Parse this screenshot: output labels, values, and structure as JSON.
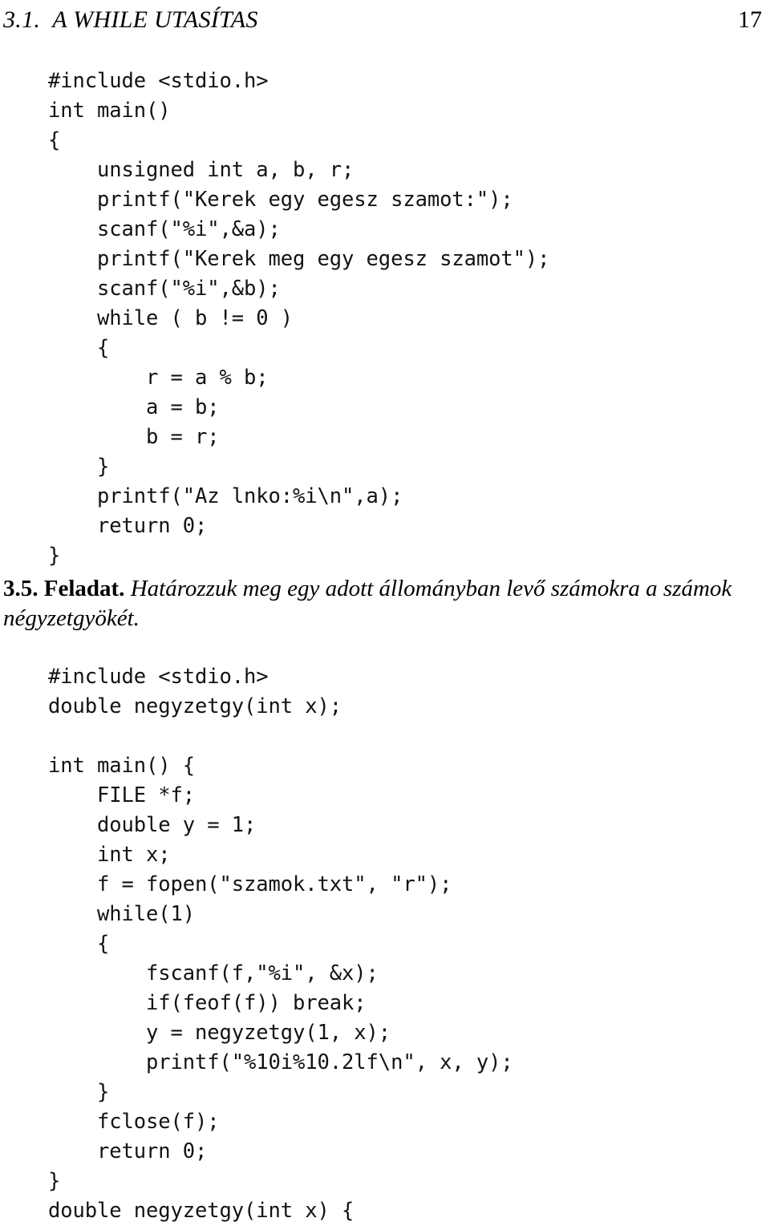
{
  "running_head": {
    "title": "3.1.  A WHILE UTASÍTAS",
    "page_number": "17"
  },
  "code_block_1": {
    "name": "lnko-euklidesz-program",
    "lines": [
      "#include <stdio.h>",
      "int main()",
      "{",
      "    unsigned int a, b, r;",
      "    printf(\"Kerek egy egesz szamot:\");",
      "    scanf(\"%i\",&a);",
      "    printf(\"Kerek meg egy egesz szamot\");",
      "    scanf(\"%i\",&b);",
      "    while ( b != 0 )",
      "    {",
      "        r = a % b;",
      "        a = b;",
      "        b = r;",
      "    }",
      "    printf(\"Az lnko:%i\\n\",a);",
      "    return 0;",
      "}"
    ]
  },
  "exercise": {
    "number": "3.5.",
    "label": "Feladat.",
    "lead": "3.5. Feladat.",
    "text": "Határozzuk meg egy adott állományban levő számokra a számok négyzetgyökét."
  },
  "code_block_2": {
    "name": "negyzetgyok-allomanybol-program",
    "lines": [
      "#include <stdio.h>",
      "double negyzetgy(int x);",
      "",
      "int main() {",
      "    FILE *f;",
      "    double y = 1;",
      "    int x;",
      "    f = fopen(\"szamok.txt\", \"r\");",
      "    while(1)",
      "    {",
      "        fscanf(f,\"%i\", &x);",
      "        if(feof(f)) break;",
      "        y = negyzetgy(1, x);",
      "        printf(\"%10i%10.2lf\\n\", x, y);",
      "    }",
      "    fclose(f);",
      "    return 0;",
      "}",
      "double negyzetgy(int x) {"
    ]
  },
  "colors": {
    "page_background": "#ffffff",
    "text": "#000000",
    "code_text": "#131313"
  }
}
